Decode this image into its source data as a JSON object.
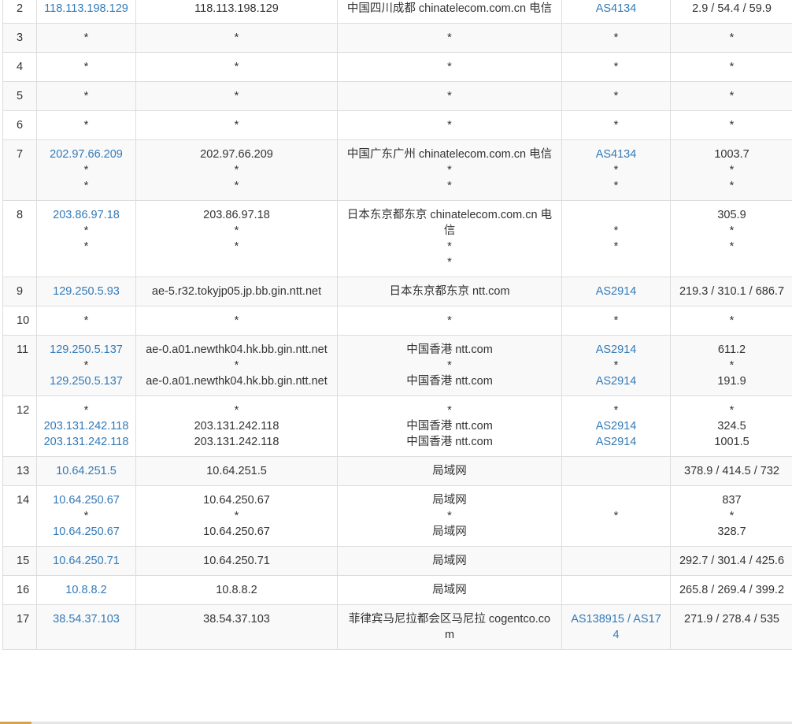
{
  "rows": [
    {
      "hop": "2",
      "ip": [
        "118.113.198.129"
      ],
      "host": [
        "118.113.198.129"
      ],
      "loc": [
        "中国四川成都 chinatelecom.com.cn 电信"
      ],
      "as": [
        "AS4134"
      ],
      "time": [
        "2.9 / 54.4 / 59.9"
      ]
    },
    {
      "hop": "3",
      "ip": [
        "*"
      ],
      "host": [
        "*"
      ],
      "loc": [
        "*"
      ],
      "as": [
        "*"
      ],
      "time": [
        "*"
      ]
    },
    {
      "hop": "4",
      "ip": [
        "*"
      ],
      "host": [
        "*"
      ],
      "loc": [
        "*"
      ],
      "as": [
        "*"
      ],
      "time": [
        "*"
      ]
    },
    {
      "hop": "5",
      "ip": [
        "*"
      ],
      "host": [
        "*"
      ],
      "loc": [
        "*"
      ],
      "as": [
        "*"
      ],
      "time": [
        "*"
      ]
    },
    {
      "hop": "6",
      "ip": [
        "*"
      ],
      "host": [
        "*"
      ],
      "loc": [
        "*"
      ],
      "as": [
        "*"
      ],
      "time": [
        "*"
      ]
    },
    {
      "hop": "7",
      "ip": [
        "202.97.66.209",
        "*",
        "*"
      ],
      "host": [
        "202.97.66.209",
        "*",
        "*"
      ],
      "loc": [
        "中国广东广州 chinatelecom.com.cn 电信",
        "*",
        "*"
      ],
      "as": [
        "AS4134",
        "*",
        "*"
      ],
      "time": [
        "1003.7",
        "*",
        "*"
      ]
    },
    {
      "hop": "8",
      "ip": [
        "203.86.97.18",
        "*",
        "*"
      ],
      "host": [
        "203.86.97.18",
        "*",
        "*"
      ],
      "loc": [
        "日本东京都东京 chinatelecom.com.cn 电信",
        "*",
        "*"
      ],
      "as": [
        "",
        "*",
        "*"
      ],
      "time": [
        "305.9",
        "*",
        "*"
      ]
    },
    {
      "hop": "9",
      "ip": [
        "129.250.5.93"
      ],
      "host": [
        "ae-5.r32.tokyjp05.jp.bb.gin.ntt.net"
      ],
      "loc": [
        "日本东京都东京 ntt.com"
      ],
      "as": [
        "AS2914"
      ],
      "time": [
        "219.3 / 310.1 / 686.7"
      ]
    },
    {
      "hop": "10",
      "ip": [
        "*"
      ],
      "host": [
        "*"
      ],
      "loc": [
        "*"
      ],
      "as": [
        "*"
      ],
      "time": [
        "*"
      ]
    },
    {
      "hop": "11",
      "ip": [
        "129.250.5.137",
        "*",
        "129.250.5.137"
      ],
      "host": [
        "ae-0.a01.newthk04.hk.bb.gin.ntt.net",
        "*",
        "ae-0.a01.newthk04.hk.bb.gin.ntt.net"
      ],
      "loc": [
        "中国香港 ntt.com",
        "*",
        "中国香港 ntt.com"
      ],
      "as": [
        "AS2914",
        "*",
        "AS2914"
      ],
      "time": [
        "611.2",
        "*",
        "191.9"
      ]
    },
    {
      "hop": "12",
      "ip": [
        "*",
        "203.131.242.118",
        "203.131.242.118"
      ],
      "host": [
        "*",
        "203.131.242.118",
        "203.131.242.118"
      ],
      "loc": [
        "*",
        "中国香港 ntt.com",
        "中国香港 ntt.com"
      ],
      "as": [
        "*",
        "AS2914",
        "AS2914"
      ],
      "time": [
        "*",
        "324.5",
        "1001.5"
      ]
    },
    {
      "hop": "13",
      "ip": [
        "10.64.251.5"
      ],
      "host": [
        "10.64.251.5"
      ],
      "loc": [
        "局域网"
      ],
      "as": [
        ""
      ],
      "time": [
        "378.9 / 414.5 / 732"
      ]
    },
    {
      "hop": "14",
      "ip": [
        "10.64.250.67",
        "*",
        "10.64.250.67"
      ],
      "host": [
        "10.64.250.67",
        "*",
        "10.64.250.67"
      ],
      "loc": [
        "局域网",
        "*",
        "局域网"
      ],
      "as": [
        "",
        "*",
        ""
      ],
      "time": [
        "837",
        "*",
        "328.7"
      ]
    },
    {
      "hop": "15",
      "ip": [
        "10.64.250.71"
      ],
      "host": [
        "10.64.250.71"
      ],
      "loc": [
        "局域网"
      ],
      "as": [
        ""
      ],
      "time": [
        "292.7 / 301.4 / 425.6"
      ]
    },
    {
      "hop": "16",
      "ip": [
        "10.8.8.2"
      ],
      "host": [
        "10.8.8.2"
      ],
      "loc": [
        "局域网"
      ],
      "as": [
        ""
      ],
      "time": [
        "265.8 / 269.4 / 399.2"
      ]
    },
    {
      "hop": "17",
      "ip": [
        "38.54.37.103"
      ],
      "host": [
        "38.54.37.103"
      ],
      "loc": [
        "菲律宾马尼拉都会区马尼拉 cogentco.com"
      ],
      "as": [
        "AS138915 / AS174"
      ],
      "time": [
        "271.9 / 278.4 / 535"
      ]
    }
  ],
  "colors": {
    "link": "#337ab7",
    "border": "#dddddd",
    "stripe": "#f9f9f9",
    "text": "#333333"
  }
}
